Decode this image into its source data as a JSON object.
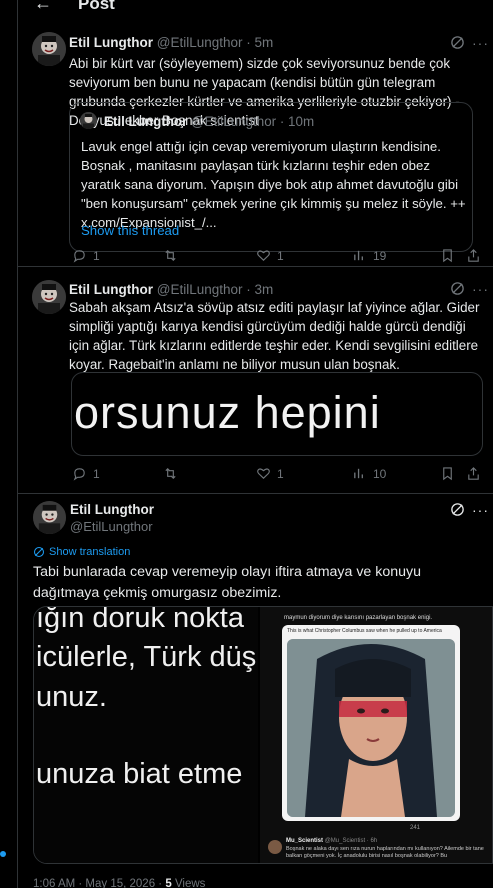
{
  "header": {
    "title": "Post",
    "back_label": "←"
  },
  "tweets": [
    {
      "name": "Etil Lungthor",
      "handle": "@EtilLungthor",
      "time": "5m",
      "text": "Abi bir kürt var (söyleyemem) sizde çok seviyorsunuz bende çok seviyorum ben bunu ne yapacam (kendisi bütün gün telegram grubunda çerkezler kürtler ve amerika yerlileriyle otuzbir çekiyor) -Deyyusu ekber Boşnak scientist",
      "quote": {
        "name": "Etil Lungthor",
        "handle": "@EtilLungthor",
        "time": "10m",
        "text": "Lavuk engel attığı için cevap veremiyorum ulaştırın kendisine. Boşnak , manitasını paylaşan türk kızlarını teşhir eden obez yaratık sana diyorum. Yapışın diye bok atıp ahmet davutoğlu gibi \"ben konuşursam\" çekmek yerine çık kimmiş şu melez it söyle. ++ x.com/Expansionist_/...",
        "show_thread": "Show this thread"
      },
      "counts": {
        "reply": "1",
        "repost": "",
        "like": "1",
        "views": "19"
      }
    },
    {
      "name": "Etil Lungthor",
      "handle": "@EtilLungthor",
      "time": "3m",
      "text": "Sabah akşam Atsız'a sövüp atsız editi paylaşır laf yiyince ağlar. Gider simpliği yaptığı karıya kendisi gürcüyüm dediği halde gürcü dendiği için ağlar. Türk kızlarını editlerde teşhir eder. Kendi sevgilisini editlere koyar. Ragebait'in anlamı ne biliyor musun ulan boşnak.",
      "media_text": "orsunuz hepini",
      "counts": {
        "reply": "1",
        "repost": "",
        "like": "1",
        "views": "10"
      }
    },
    {
      "name": "Etil Lungthor",
      "handle": "@EtilLungthor",
      "show_translation": "Show translation",
      "text": "Tabi bunlarada cevap veremeyip olayı iftira atmaya ve konuyu dağıtmaya çekmiş omurgasız obezimiz.",
      "media_left_lines": [
        "ığın doruk nokta",
        "icülerle, Türk düş",
        "unuz.",
        "unuza biat etme"
      ],
      "media_right": {
        "top_caption": "maymun diyorum diye karısını pazarlayan boşnak enigi.",
        "inner_caption": "This is what Christopher Columbus saw when he pulled up to America",
        "reply_name": "Mu_Scientist",
        "reply_handle": "@Mu_Scientist · 6h",
        "reply_text": "Boşnak ne alaka dayı sen rıza nurun haplarından mı kullanıyon? Ailemde bir tane balkan göçmeni yok. İç anadolulu birisi nasıl boşnak olabiliyor? Bu",
        "count_a": "241"
      },
      "footer": {
        "time": "1:06 AM · May 15, 2026 ·",
        "views_count": "5",
        "views_label": "Views"
      }
    }
  ],
  "colors": {
    "accent": "#1d9bf0",
    "muted": "#71767b",
    "border": "#2f3336"
  }
}
